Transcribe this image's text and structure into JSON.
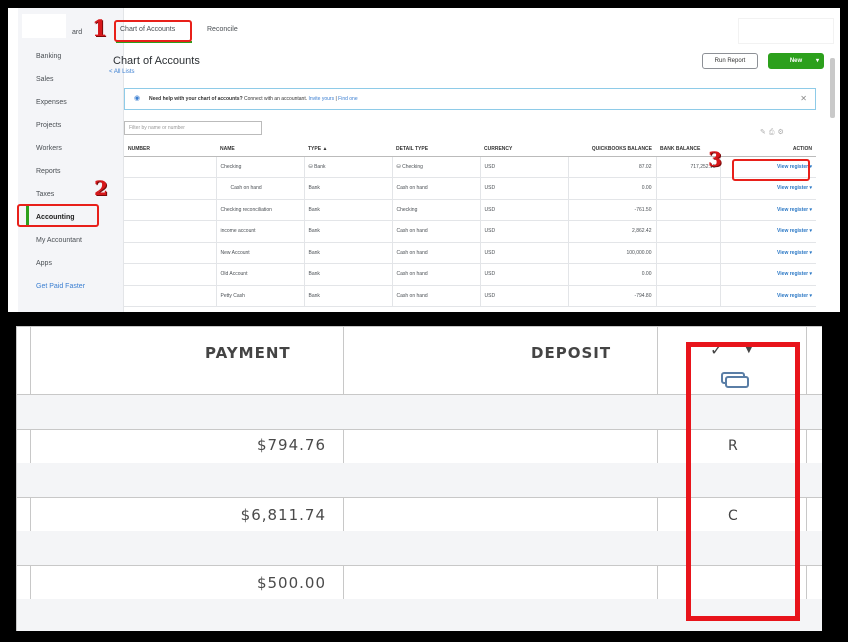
{
  "sidebar": {
    "dashboard_suffix": "ard",
    "items": [
      {
        "label": "Banking"
      },
      {
        "label": "Sales"
      },
      {
        "label": "Expenses"
      },
      {
        "label": "Projects"
      },
      {
        "label": "Workers"
      },
      {
        "label": "Reports"
      },
      {
        "label": "Taxes"
      },
      {
        "label": "Accounting"
      },
      {
        "label": "My Accountant"
      },
      {
        "label": "Apps"
      },
      {
        "label": "Get Paid Faster"
      }
    ]
  },
  "tabs": [
    {
      "label": "Chart of Accounts"
    },
    {
      "label": "Reconcile"
    }
  ],
  "annotations": {
    "step1": "1",
    "step2": "2",
    "step3": "3",
    "color": "#e8201a"
  },
  "page": {
    "title": "Chart of Accounts",
    "back_link": "< All Lists",
    "run_report": "Run Report",
    "new_button": "New",
    "new_caret": "▾",
    "help_bold": "Need help with your chart of accounts?",
    "help_text": " Connect with an accountant. ",
    "help_link1": "Invite yours",
    "help_sep": " | ",
    "help_link2": "Find one",
    "filter_placeholder": "Filter by name or number",
    "brand_color": "#2ca01c",
    "link_color": "#3a7ed1"
  },
  "table": {
    "headers": [
      "NUMBER",
      "NAME",
      "TYPE ▲",
      "DETAIL TYPE",
      "CURRENCY",
      "QUICKBOOKS BALANCE",
      "BANK BALANCE",
      "ACTION"
    ],
    "rows": [
      {
        "number": "",
        "name": "Checking",
        "type": "Bank",
        "detail": "Checking",
        "currency": "USD",
        "qb_balance": "87.02",
        "bank_balance": "717,252.15",
        "action": "View register"
      },
      {
        "number": "",
        "name": "Cash on hand",
        "type": "Bank",
        "detail": "Cash on hand",
        "currency": "USD",
        "qb_balance": "0.00",
        "bank_balance": "",
        "action": "View register"
      },
      {
        "number": "",
        "name": "Checking reconciliation",
        "type": "Bank",
        "detail": "Checking",
        "currency": "USD",
        "qb_balance": "-761.50",
        "bank_balance": "",
        "action": "View register"
      },
      {
        "number": "",
        "name": "income account",
        "type": "Bank",
        "detail": "Cash on hand",
        "currency": "USD",
        "qb_balance": "2,862.42",
        "bank_balance": "",
        "action": "View register"
      },
      {
        "number": "",
        "name": "New Account",
        "type": "Bank",
        "detail": "Cash on hand",
        "currency": "USD",
        "qb_balance": "100,000.00",
        "bank_balance": "",
        "action": "View register"
      },
      {
        "number": "",
        "name": "Old Account",
        "type": "Bank",
        "detail": "Cash on hand",
        "currency": "USD",
        "qb_balance": "0.00",
        "bank_balance": "",
        "action": "View register"
      },
      {
        "number": "",
        "name": "Petty Cash",
        "type": "Bank",
        "detail": "Cash on hand",
        "currency": "USD",
        "qb_balance": "-794.80",
        "bank_balance": "",
        "action": "View register"
      }
    ]
  },
  "register": {
    "headers": {
      "payment": "PAYMENT",
      "deposit": "DEPOSIT",
      "check": "✓"
    },
    "rows": [
      {
        "payment": "$794.76",
        "deposit": "",
        "status": "R"
      },
      {
        "payment": "$6,811.74",
        "deposit": "",
        "status": "C"
      },
      {
        "payment": "$500.00",
        "deposit": "",
        "status": ""
      }
    ]
  }
}
